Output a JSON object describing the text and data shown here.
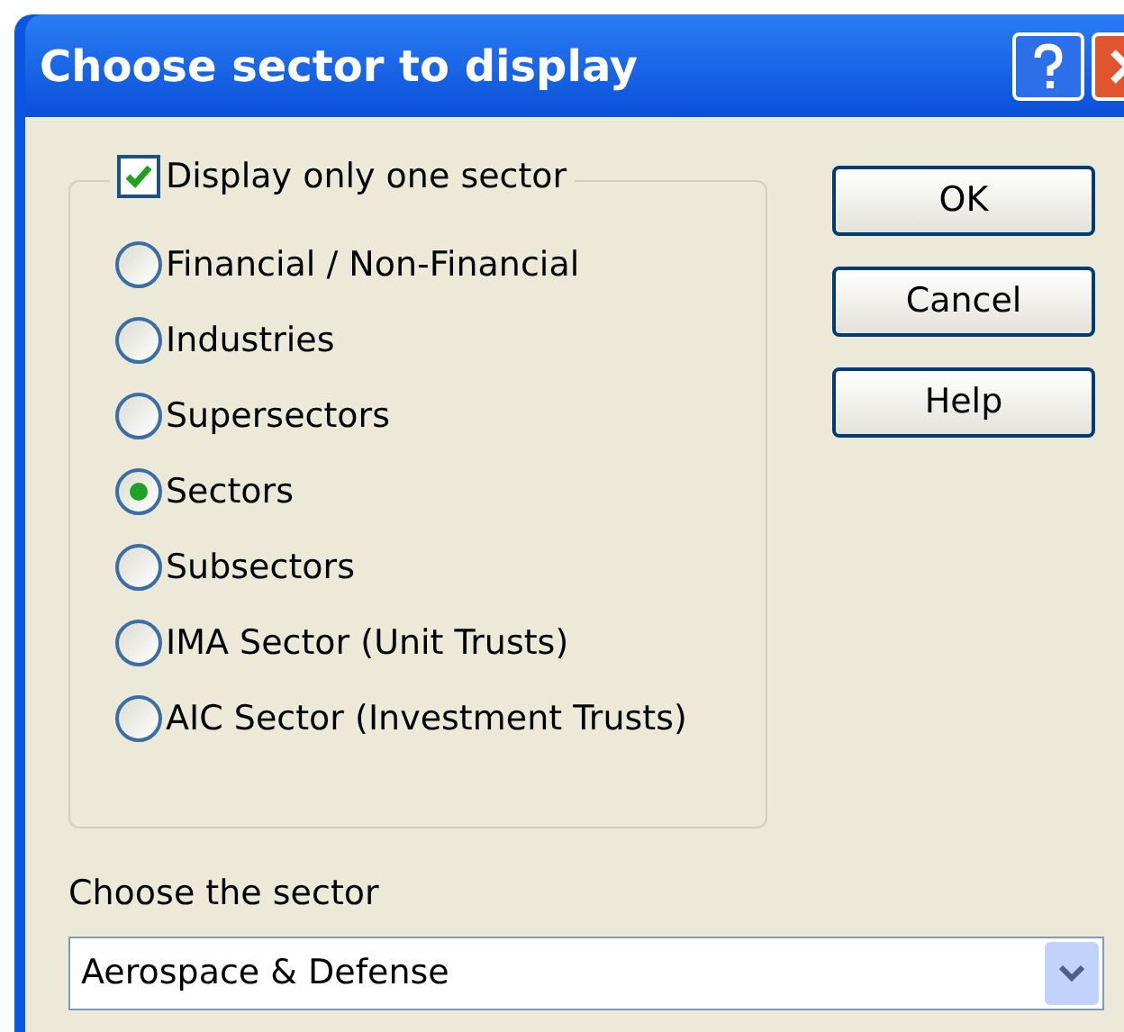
{
  "window": {
    "title": "Choose sector to display"
  },
  "group": {
    "checkbox": {
      "label": "Display only one sector",
      "checked": true
    },
    "options": [
      {
        "label": "Financial / Non-Financial",
        "selected": false
      },
      {
        "label": "Industries",
        "selected": false
      },
      {
        "label": "Supersectors",
        "selected": false
      },
      {
        "label": "Sectors",
        "selected": true
      },
      {
        "label": "Subsectors",
        "selected": false
      },
      {
        "label": "IMA Sector (Unit Trusts)",
        "selected": false
      },
      {
        "label": "AIC Sector (Investment Trusts)",
        "selected": false
      }
    ]
  },
  "buttons": [
    "OK",
    "Cancel",
    "Help"
  ],
  "sector": {
    "label": "Choose the sector",
    "value": "Aerospace & Defense"
  }
}
